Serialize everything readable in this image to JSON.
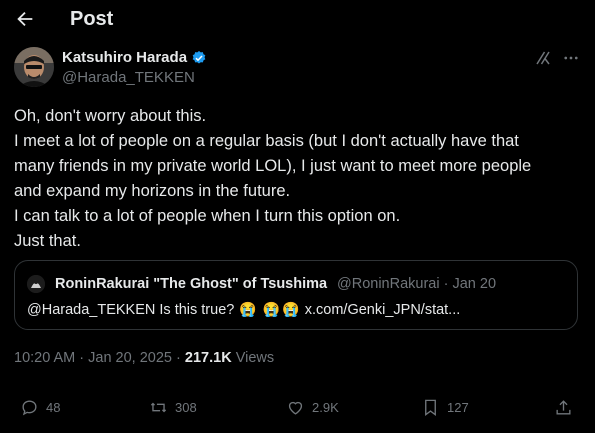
{
  "header": {
    "title": "Post"
  },
  "author": {
    "name": "Katsuhiro Harada",
    "handle": "@Harada_TEKKEN"
  },
  "tweet": {
    "lines": [
      "Oh, don't worry about this.",
      "I meet a lot of people on a regular basis (but I don't actually have that",
      "many friends in my private world LOL), I just want to meet more people",
      "and expand my horizons in the future.",
      "I can talk to a lot of people when I turn this option on.",
      "Just that."
    ]
  },
  "quote": {
    "name": "RoninRakurai \"The Ghost\" of Tsushima",
    "handle": "@RoninRakurai",
    "separator": "·",
    "date": "Jan 20",
    "text_prefix": "@Harada_TEKKEN Is this true?",
    "emoji": "😭",
    "link": "x.com/Genki_JPN/stat..."
  },
  "meta": {
    "time": "10:20 AM · Jan 20, 2025",
    "separator": "·",
    "views_count": "217.1K",
    "views_label": "Views"
  },
  "actions": {
    "replies": "48",
    "reposts": "308",
    "likes": "2.9K",
    "bookmarks": "127"
  },
  "colors": {
    "background": "#000000",
    "text": "#e7e9ea",
    "muted": "#71767b",
    "border": "#2f3336",
    "verified": "#1d9bf0"
  }
}
